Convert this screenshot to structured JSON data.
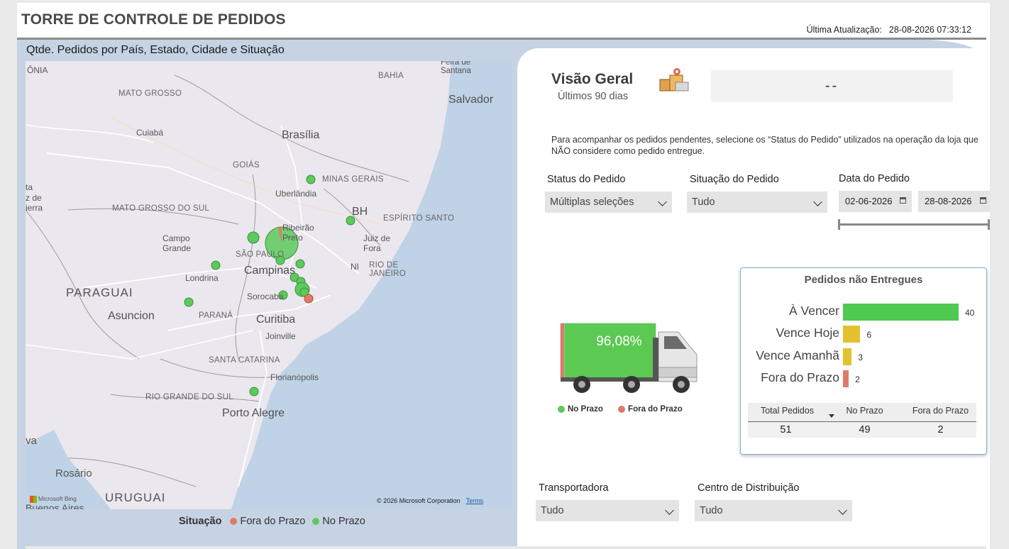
{
  "header": {
    "title": "TORRE DE CONTROLE DE PEDIDOS",
    "update_label": "Última Atualização:",
    "update_value": "28-08-2026 07:33:12"
  },
  "map": {
    "title": "Qtde. Pedidos por País, Estado, Cidade e Situação",
    "labels": {
      "rondonia": "ÔNIA",
      "mato_grosso": "MATO GROSSO",
      "bahia": "BAHIA",
      "feira": "Feira de Santana",
      "salvador": "Salvador",
      "cuiaba": "Cuiabá",
      "brasilia": "Brasília",
      "goias": "GOIÁS",
      "minas": "MINAS GERAIS",
      "uberlandia": "Uberlândia",
      "ms": "MATO GROSSO DO SUL",
      "bh": "BH",
      "es": "ESPÍRITO SANTO",
      "ribeirao": "Ribeirão Preto",
      "campo_grande": "Campo Grande",
      "juiz_de_fora": "Juiz de Fora",
      "sao_paulo": "SÃO PAULO",
      "campinas": "Campinas",
      "rj": "RIO DE JANEIRO",
      "ni": "NI",
      "londrina": "Londrina",
      "paraguai": "PARAGUAI",
      "sorocaba": "Sorocaba",
      "asuncion": "Asuncion",
      "parana": "PARANÁ",
      "curitiba": "Curitiba",
      "joinville": "Joinville",
      "sc": "SANTA CATARINA",
      "florianopolis": "Florianópolis",
      "rs": "RIO GRANDE DO SUL",
      "porto_alegre": "Porto Alegre",
      "rosario": "Rosário",
      "uruguai": "URUGUAI",
      "buenos_aires": "Buenos Aires",
      "left_edge_1": "ta",
      "left_edge_2": "z de",
      "left_edge_3": "ierra",
      "left_edge_4": "va"
    },
    "copyright": "© 2026 Microsoft Corporation",
    "terms": "Terms",
    "bing": "Microsoft Bing",
    "legend_title": "Situação",
    "legend_items": [
      "Fora do Prazo",
      "No Prazo"
    ]
  },
  "colors": {
    "no_prazo": "#5cc95c",
    "fora_do_prazo": "#e07a68",
    "vence_hoje": "#e2c22c",
    "panel_band": "#c5d3e4",
    "truck_green": "#5bc952"
  },
  "overview": {
    "title": "Visão Geral",
    "subtitle": "Últimos 90 dias",
    "kpi_value": "--",
    "description": "Para acompanhar os pedidos pendentes, selecione os “Status do Pedido” utilizados na operação da loja que NÃO considere como pedido entregue."
  },
  "filters": {
    "status_label": "Status do Pedido",
    "status_value": "Múltiplas seleções",
    "situacao_label": "Situação do Pedido",
    "situacao_value": "Tudo",
    "data_label": "Data do Pedido",
    "date_from": "02-06-2026",
    "date_to": "28-08-2026",
    "transportadora_label": "Transportadora",
    "transportadora_value": "Tudo",
    "cd_label": "Centro de Distribuição",
    "cd_value": "Tudo"
  },
  "truck": {
    "percent": "96,08%",
    "percent_value": 96.08,
    "legend_no_prazo": "No Prazo",
    "legend_fora": "Fora do Prazo"
  },
  "chart_data": {
    "type": "bar",
    "title": "Pedidos não Entregues",
    "categories": [
      "À Vencer",
      "Vence Hoje",
      "Vence Amanhã",
      "Fora do Prazo"
    ],
    "values": [
      40,
      6,
      3,
      2
    ],
    "value_labels": [
      "40",
      "6",
      "3",
      "2"
    ],
    "colors": [
      "#4fc94f",
      "#e2c22c",
      "#e2c22c",
      "#e07a68"
    ],
    "orientation": "horizontal",
    "xlim": [
      0,
      40
    ]
  },
  "summary_table": {
    "headers": [
      "Total Pedidos",
      "No Prazo",
      "Fora do Prazo"
    ],
    "values": [
      "51",
      "49",
      "2"
    ]
  }
}
